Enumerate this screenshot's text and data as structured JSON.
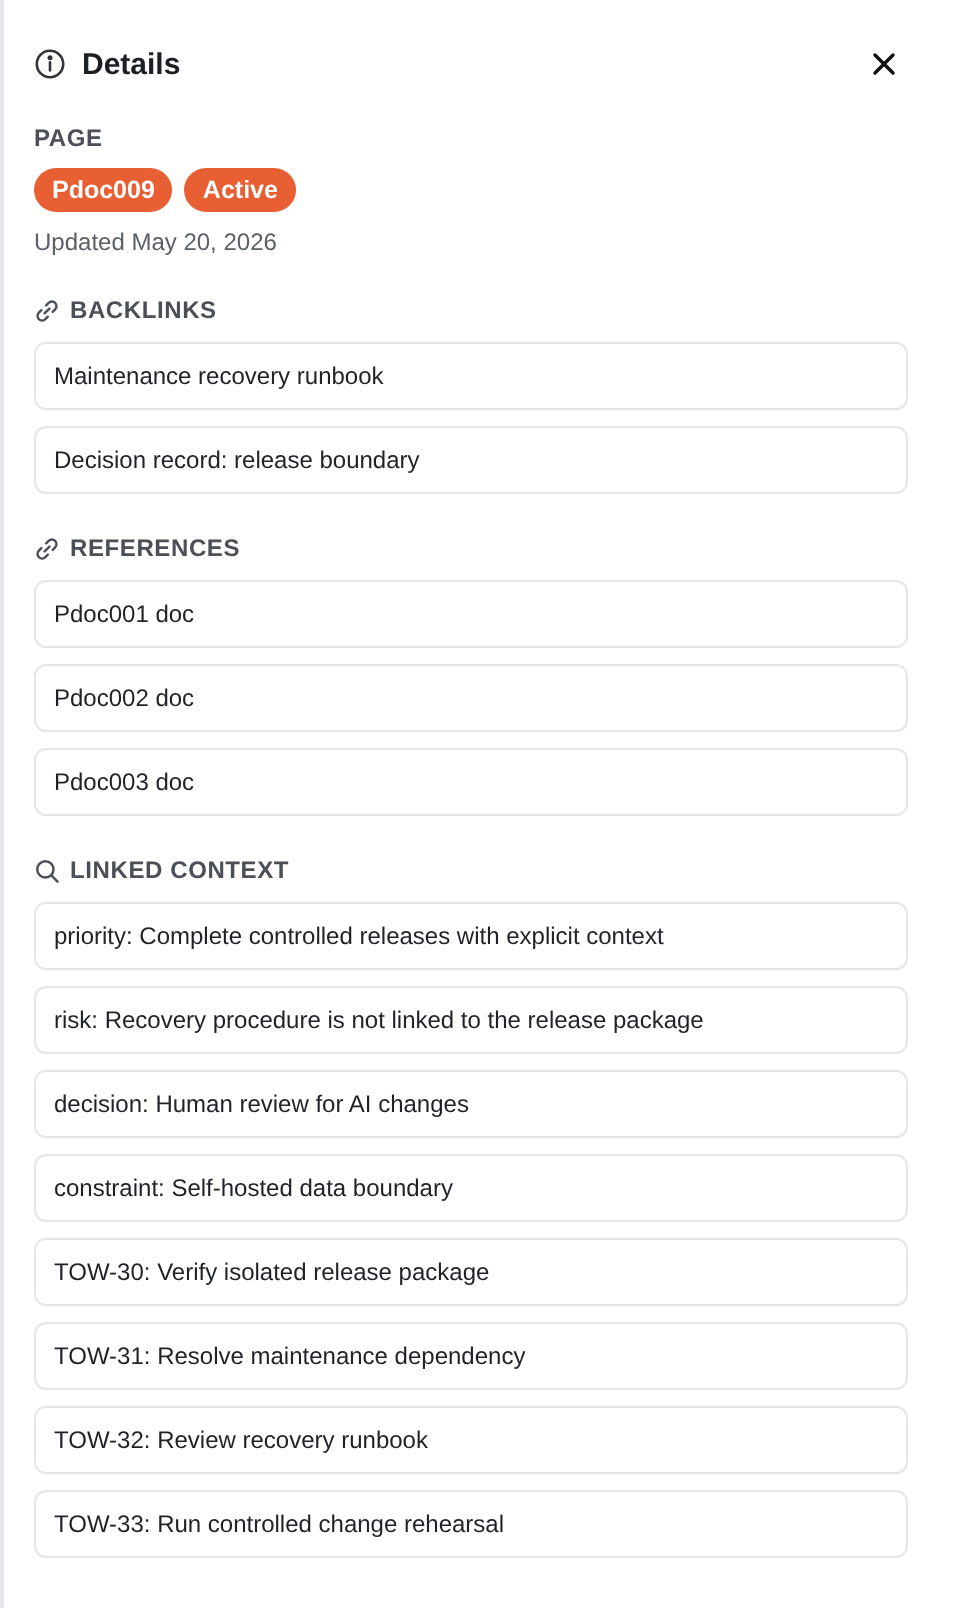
{
  "header": {
    "title": "Details"
  },
  "page": {
    "label": "PAGE",
    "badges": [
      "Pdoc009",
      "Active"
    ],
    "updated": "Updated May 20, 2026"
  },
  "sections": [
    {
      "title": "BACKLINKS",
      "kind": "link",
      "items": [
        "Maintenance recovery runbook",
        "Decision record: release boundary"
      ]
    },
    {
      "title": "REFERENCES",
      "kind": "link",
      "items": [
        "Pdoc001 doc",
        "Pdoc002 doc",
        "Pdoc003 doc"
      ]
    },
    {
      "title": "LINKED CONTEXT",
      "kind": "search",
      "items": [
        "priority: Complete controlled releases with explicit context",
        "risk: Recovery procedure is not linked to the release package",
        "decision: Human review for AI changes",
        "constraint: Self-hosted data boundary",
        "TOW-30: Verify isolated release package",
        "TOW-31: Resolve maintenance dependency",
        "TOW-32: Review recovery runbook",
        "TOW-33: Run controlled change rehearsal"
      ]
    }
  ]
}
